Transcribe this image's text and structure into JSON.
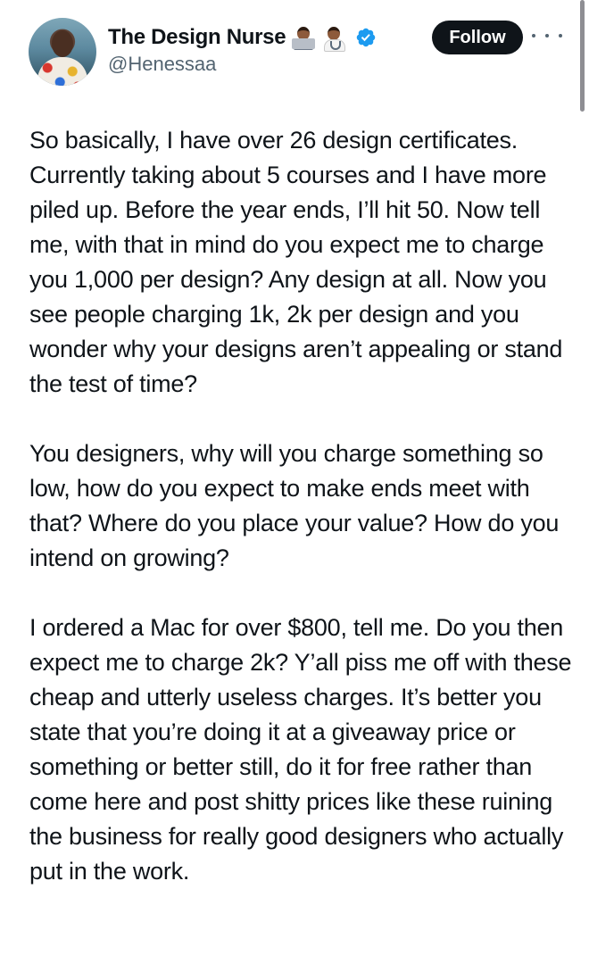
{
  "tweet": {
    "author": {
      "display_name": "The Design Nurse",
      "handle": "@Henessaa",
      "name_emojis": [
        "technologist-emoji",
        "health-worker-emoji"
      ],
      "verified": true
    },
    "follow_label": "Follow",
    "paragraphs": [
      "So basically, I have over 26 design certificates. Currently taking about 5 courses and I have more piled up. Before the year ends, I’ll hit 50. Now tell me, with that in mind do you expect me to charge you 1,000 per design? Any design at all. Now you see people charging 1k, 2k per design and you wonder why your designs aren’t appealing or stand the test of time?",
      "You designers, why will you charge something so low, how do you expect to make ends meet with that? Where do you place your value? How do you intend on growing?",
      "I ordered a Mac for over $800, tell me. Do you then expect me to charge 2k? Y’all piss me off with these cheap and utterly useless charges. It’s better you state that you’re doing it at a giveaway price or something or better still, do it for free rather than come here and post shitty prices like these ruining the business for really good designers who actually put in the work."
    ]
  },
  "colors": {
    "text": "#0f1419",
    "secondary": "#536471",
    "follow_bg": "#0f1419",
    "verified": "#1d9bf0"
  }
}
